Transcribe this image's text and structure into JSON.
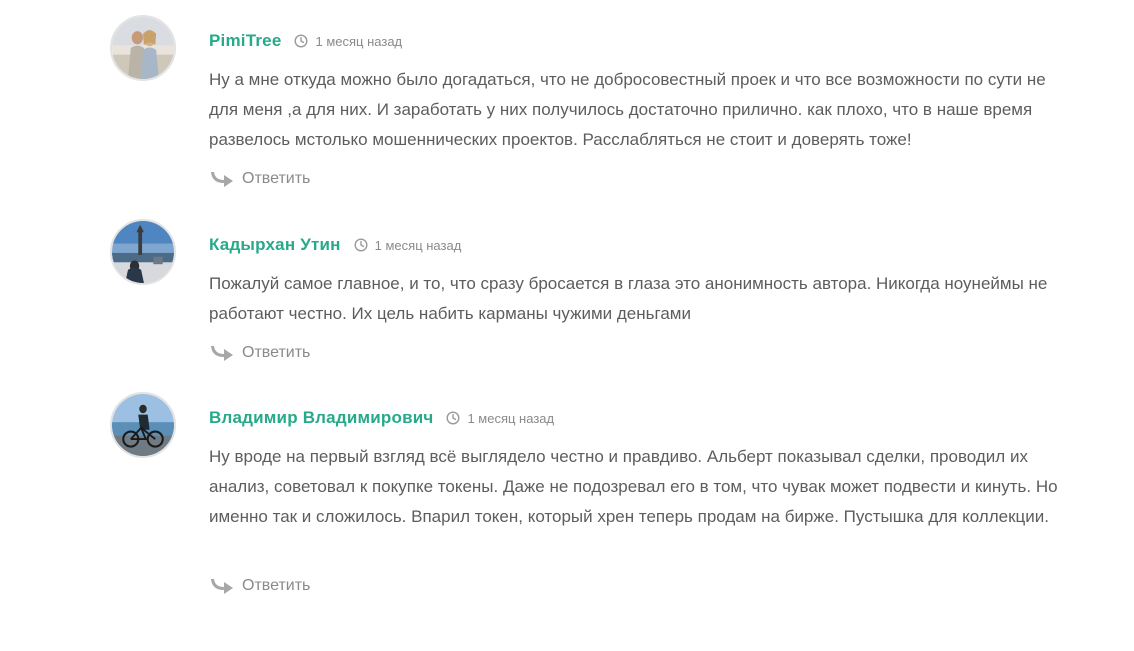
{
  "comments": [
    {
      "author": "PimiTree",
      "time": "1 месяц назад",
      "text": "Ну а мне откуда можно было догадаться, что не добросовестный проек и что все возможности по сути не для меня ,а для них. И заработать у них получилось достаточно прилично. как плохо, что в наше время развелось мстолько мошеннических проектов. Расслабляться не стоит и доверять тоже!",
      "reply_label": "Ответить"
    },
    {
      "author": "Кадырхан Утин",
      "time": "1 месяц назад",
      "text": "Пожалуй самое главное, и то, что сразу бросается в глаза это анонимность автора. Никогда ноунеймы не работают честно. Их цель набить карманы чужими деньгами",
      "reply_label": "Ответить"
    },
    {
      "author": "Владимир Владимирович",
      "time": "1 месяц назад",
      "text": "Ну вроде на первый взгляд всё выглядело честно и правдиво. Альберт показывал сделки, проводил их анализ, советовал к покупке токены. Даже не подозревал его в том, что чувак может подвести и кинуть. Но именно так и сложилось. Впарил токен, который хрен теперь продам на бирже. Пустышка для коллекции.",
      "reply_label": "Ответить"
    }
  ],
  "icons": {
    "time": "clock-icon",
    "reply": "reply-arrow-icon"
  },
  "colors": {
    "author": "#27a98a",
    "text": "#5d5d5d",
    "muted": "#8a8a8a",
    "avatar_border": "#e3e3e3"
  }
}
